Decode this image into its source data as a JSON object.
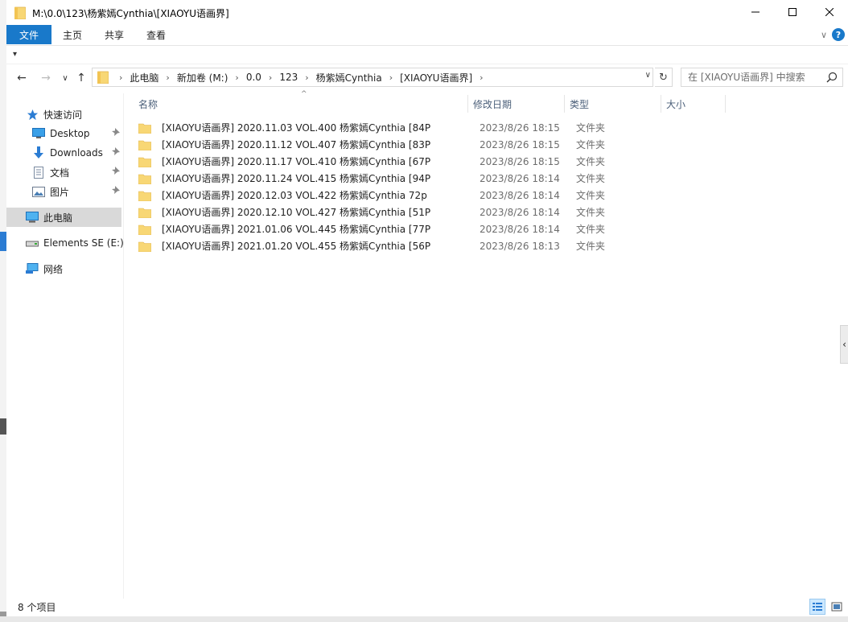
{
  "window": {
    "title": "M:\\0.0\\123\\杨紫嫣Cynthia\\[XIAOYU语画界]",
    "controls": {
      "minimize": "—",
      "maximize": "☐",
      "close": "✕"
    }
  },
  "ribbon": {
    "tabs": [
      {
        "label": "文件"
      },
      {
        "label": "主页"
      },
      {
        "label": "共享"
      },
      {
        "label": "查看"
      }
    ],
    "help_glyph": "?",
    "expand_glyph": "∨"
  },
  "quick_access": {
    "glyph": "▾"
  },
  "nav": {
    "back": "←",
    "forward": "→",
    "recent": "∨",
    "up": "↑",
    "breadcrumbs": [
      "此电脑",
      "新加卷 (M:)",
      "0.0",
      "123",
      "杨紫嫣Cynthia",
      "[XIAOYU语画界]"
    ],
    "separator": "›",
    "dropdown_glyph": "∨",
    "refresh_glyph": "↻"
  },
  "search": {
    "placeholder": "在 [XIAOYU语画界] 中搜索"
  },
  "sidebar": {
    "items": [
      {
        "label": "快速访问",
        "icon": "star-icon"
      },
      {
        "label": "Desktop",
        "icon": "desktop-icon",
        "pin": "📌"
      },
      {
        "label": "Downloads",
        "icon": "download-icon",
        "pin": "📌"
      },
      {
        "label": "文档",
        "icon": "document-icon",
        "pin": "📌"
      },
      {
        "label": "图片",
        "icon": "picture-icon",
        "pin": "📌"
      },
      {
        "label": "此电脑",
        "icon": "computer-icon",
        "selected": true
      },
      {
        "label": "Elements SE (E:)",
        "icon": "drive-icon"
      },
      {
        "label": "网络",
        "icon": "network-icon"
      }
    ]
  },
  "columns": {
    "name": "名称",
    "date": "修改日期",
    "type": "类型",
    "size": "大小",
    "sort_glyph": "^"
  },
  "files": [
    {
      "name": "[XIAOYU语画界] 2020.11.03 VOL.400 杨紫嫣Cynthia [84P",
      "date": "2023/8/26 18:15",
      "type": "文件夹"
    },
    {
      "name": "[XIAOYU语画界] 2020.11.12 VOL.407 杨紫嫣Cynthia [83P",
      "date": "2023/8/26 18:15",
      "type": "文件夹"
    },
    {
      "name": "[XIAOYU语画界] 2020.11.17 VOL.410 杨紫嫣Cynthia [67P",
      "date": "2023/8/26 18:15",
      "type": "文件夹"
    },
    {
      "name": "[XIAOYU语画界] 2020.11.24 VOL.415 杨紫嫣Cynthia [94P",
      "date": "2023/8/26 18:14",
      "type": "文件夹"
    },
    {
      "name": "[XIAOYU语画界] 2020.12.03 VOL.422 杨紫嫣Cynthia 72p",
      "date": "2023/8/26 18:14",
      "type": "文件夹"
    },
    {
      "name": "[XIAOYU语画界] 2020.12.10 VOL.427 杨紫嫣Cynthia [51P",
      "date": "2023/8/26 18:14",
      "type": "文件夹"
    },
    {
      "name": "[XIAOYU语画界] 2021.01.06 VOL.445 杨紫嫣Cynthia [77P",
      "date": "2023/8/26 18:14",
      "type": "文件夹"
    },
    {
      "name": "[XIAOYU语画界] 2021.01.20 VOL.455 杨紫嫣Cynthia [56P",
      "date": "2023/8/26 18:13",
      "type": "文件夹"
    }
  ],
  "status": {
    "count": "8 个项目"
  },
  "side_handle": {
    "glyph": "‹"
  },
  "colors": {
    "accent": "#1979ca",
    "folder": "#f8d775",
    "folder_dark": "#e8b84a",
    "selected": "#d9d9d9"
  }
}
